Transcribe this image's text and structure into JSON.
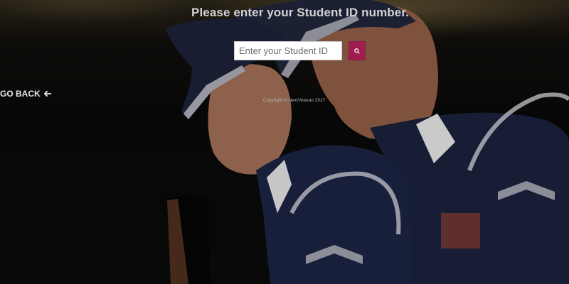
{
  "page": {
    "heading": "Please enter your Student ID number.",
    "search": {
      "placeholder": "Enter your Student ID",
      "button_icon": "search-icon"
    },
    "go_back": {
      "label": "GO BACK",
      "icon": "arrow-left-icon"
    },
    "copyright": "Copyright © NextVeteran  2017",
    "colors": {
      "accent": "#a01d4f",
      "heading": "#d2d2d2",
      "uniform": "#1a2240"
    }
  }
}
